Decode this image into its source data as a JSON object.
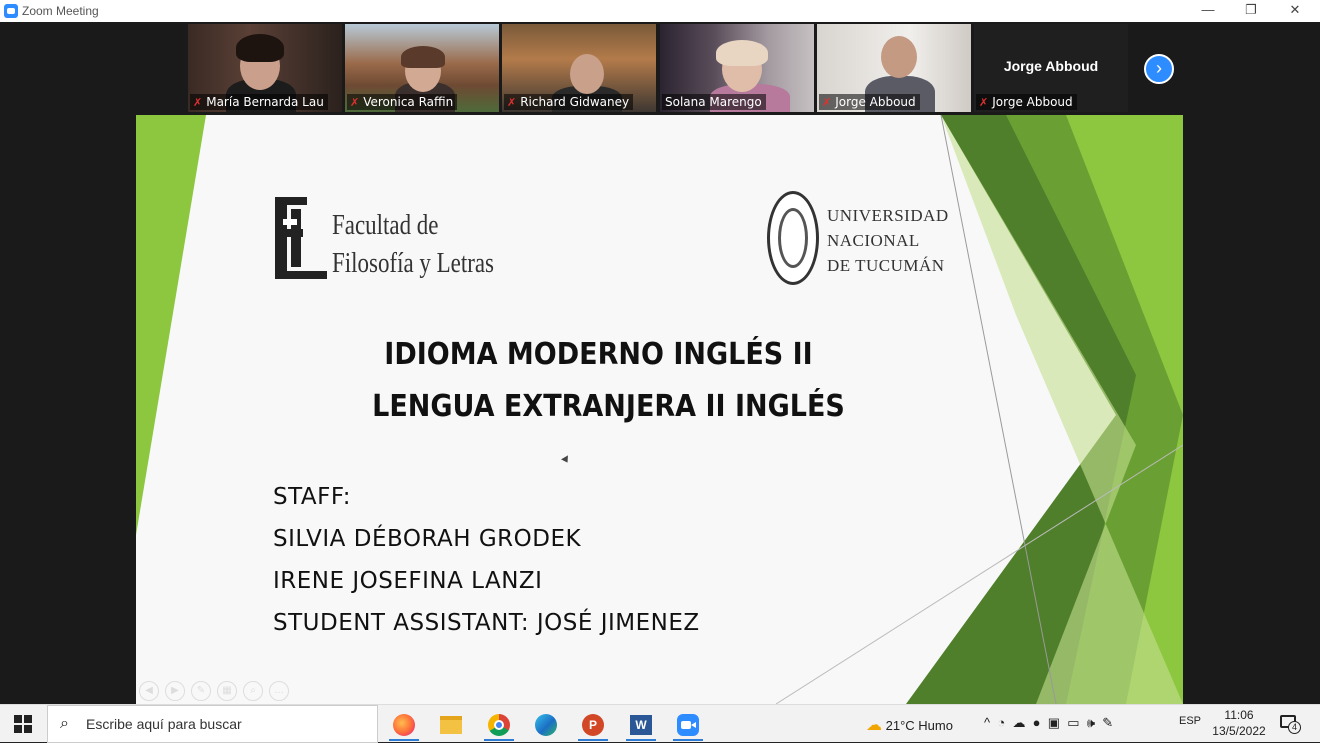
{
  "window": {
    "title": "Zoom Meeting",
    "controls": {
      "minimize": "—",
      "restore": "❐",
      "close": "✕"
    }
  },
  "participants": [
    {
      "name": "María Bernarda Lau",
      "muted": true
    },
    {
      "name": "Veronica Raffin",
      "muted": true,
      "active": true
    },
    {
      "name": "Richard Gidwaney",
      "muted": true
    },
    {
      "name": "Solana Marengo",
      "muted": false
    },
    {
      "name": "Jorge Abboud",
      "muted": true
    },
    {
      "name": "Jorge Abboud",
      "muted": true,
      "video_off_label": "Jorge Abboud"
    }
  ],
  "next_page_icon": "chevron-right-icon",
  "slide": {
    "faculty_logo_letters": "FL",
    "faculty_line1": "Facultad de",
    "faculty_line2": "Filosofía y Letras",
    "university_line1": "UNIVERSIDAD",
    "university_line2": "NACIONAL",
    "university_line3": "DE TUCUMÁN",
    "title_line1": "IDIOMA MODERNO INGLÉS II",
    "title_line2": "LENGUA EXTRANJERA II INGLÉS",
    "staff_heading": "STAFF:",
    "staff_member1": "SILVIA DÉBORAH GRODEK",
    "staff_member2": "IRENE JOSEFINA LANZI",
    "student_assistant": "STUDENT ASSISTANT:  JOSÉ JIMENEZ",
    "accent_colors": [
      "#8dc63f",
      "#6aa033",
      "#4f7f2a",
      "#c5e08f"
    ]
  },
  "taskbar": {
    "search_placeholder": "Escribe aquí para buscar",
    "weather": "21°C  Humo",
    "language": "ESP",
    "time": "11:06",
    "date": "13/5/2022",
    "notifications_count": "4",
    "apps": [
      "firefox-icon",
      "file-explorer-icon",
      "chrome-icon",
      "edge-icon",
      "powerpoint-icon",
      "word-icon",
      "zoom-icon"
    ]
  }
}
